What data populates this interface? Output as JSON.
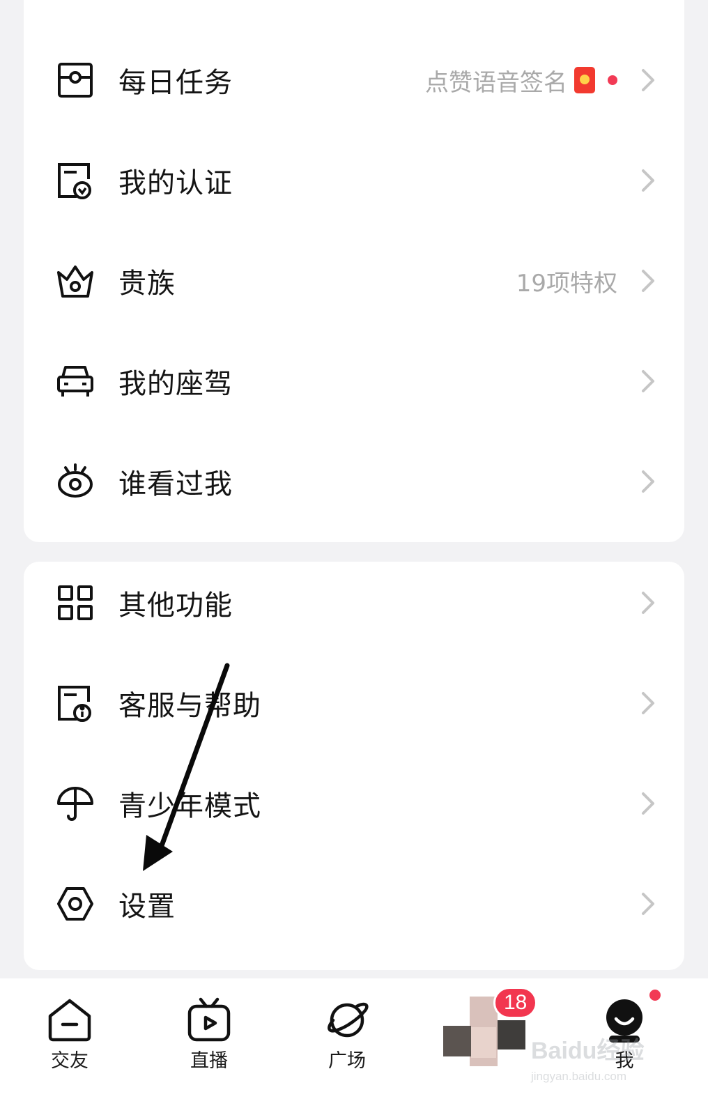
{
  "menu_group_1": [
    {
      "label": "每日任务",
      "icon": "daily-task-icon",
      "sub": "点赞语音签名",
      "has_redpacket": true,
      "has_dot": true
    },
    {
      "label": "我的认证",
      "icon": "verification-icon",
      "sub": ""
    },
    {
      "label": "贵族",
      "icon": "crown-icon",
      "sub": "19项特权"
    },
    {
      "label": "我的座驾",
      "icon": "car-icon",
      "sub": ""
    },
    {
      "label": "谁看过我",
      "icon": "eye-icon",
      "sub": ""
    }
  ],
  "menu_group_2": [
    {
      "label": "其他功能",
      "icon": "grid-icon",
      "sub": ""
    },
    {
      "label": "客服与帮助",
      "icon": "help-info-icon",
      "sub": ""
    },
    {
      "label": "青少年模式",
      "icon": "umbrella-icon",
      "sub": ""
    },
    {
      "label": "设置",
      "icon": "settings-icon",
      "sub": ""
    }
  ],
  "tabbar": {
    "tabs": [
      {
        "label": "交友",
        "icon": "home-icon"
      },
      {
        "label": "直播",
        "icon": "tv-play-icon"
      },
      {
        "label": "广场",
        "icon": "planet-icon"
      },
      {
        "label": "",
        "icon": "avatar-blurred"
      },
      {
        "label": "我",
        "icon": "profile-face-icon"
      }
    ],
    "message_badge": "18"
  },
  "colors": {
    "accent_red": "#f2364f",
    "card_bg": "#ffffff",
    "page_bg": "#f2f2f4",
    "secondary_text": "#a9a9a9"
  },
  "watermark": {
    "brand": "Baidu经验",
    "url": "jingyan.baidu.com"
  }
}
